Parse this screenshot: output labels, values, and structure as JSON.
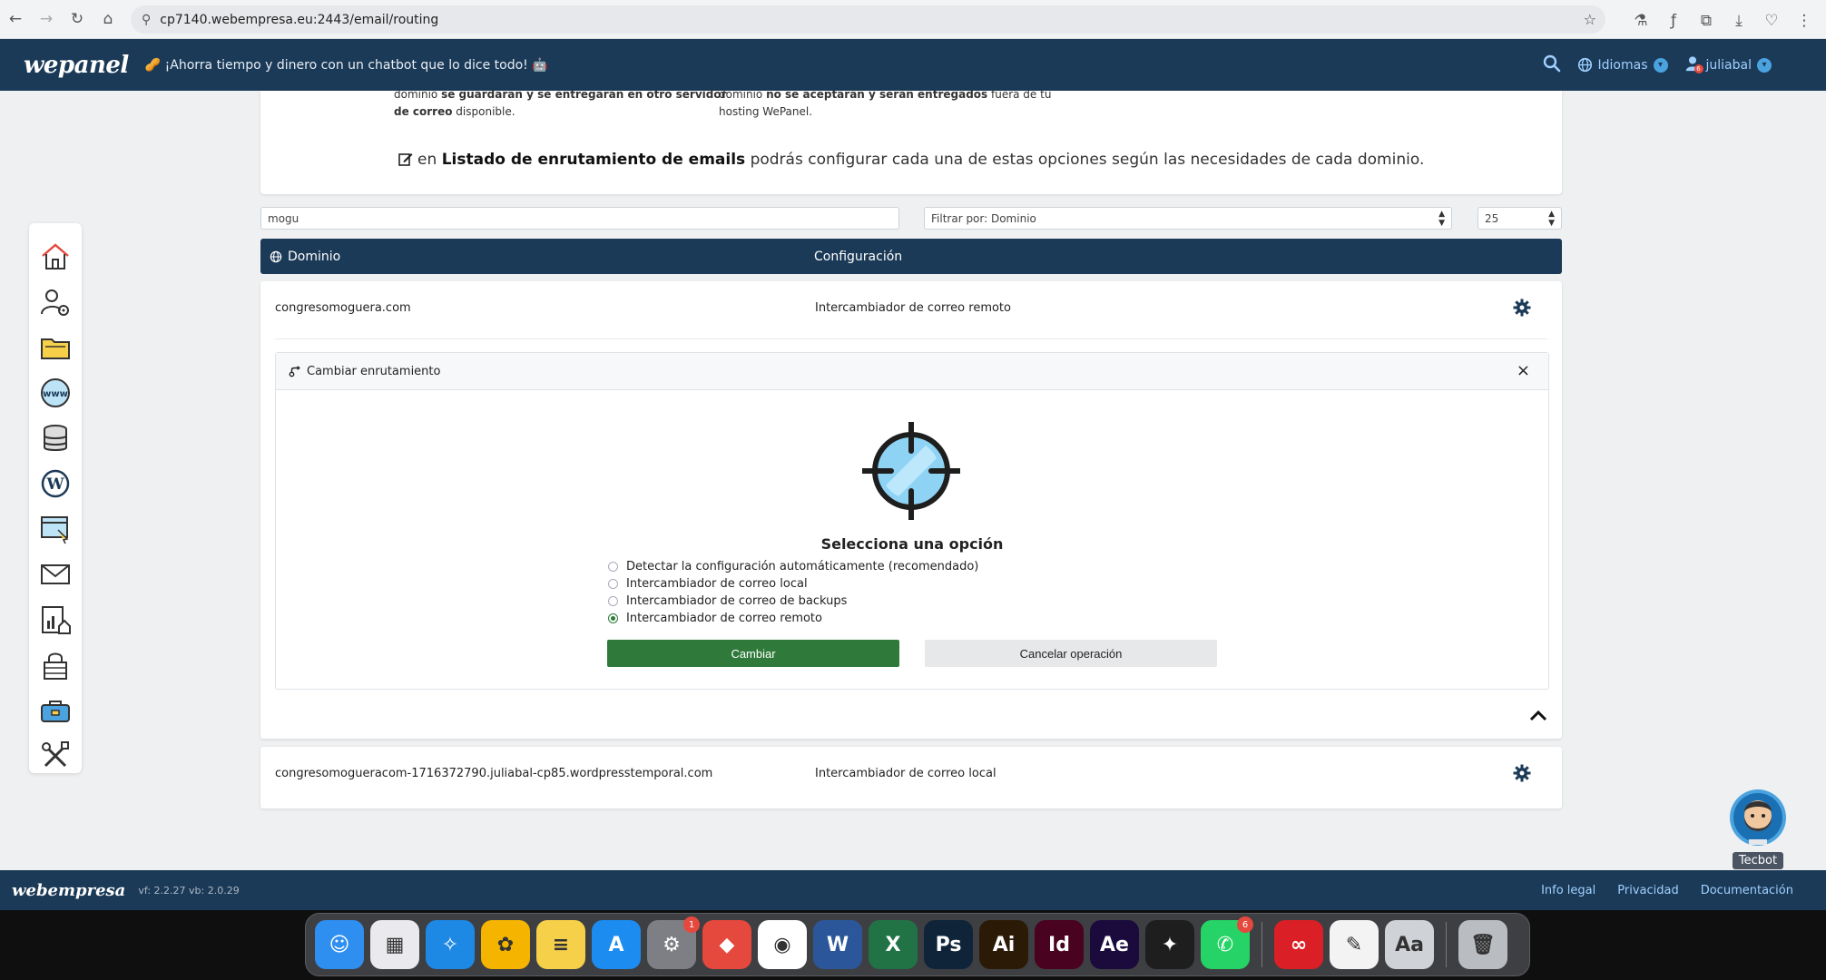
{
  "browser": {
    "url": "cp7140.webempresa.eu:2443/email/routing"
  },
  "topbar": {
    "logo": "wepanel",
    "promo": "🥜 ¡Ahorra tiempo y dinero con un chatbot que lo dice todo! 🤖",
    "languages_label": "Idiomas",
    "user_label": "juliabal",
    "user_badge": "6"
  },
  "info": {
    "col1_line1_pre": "dominio ",
    "col1_line1_bold": "se guardarán y se entregarán en otro servidor",
    "col1_line2_bold": "de correo",
    "col1_line2_post": " disponible.",
    "col2_line1_pre": "dominio ",
    "col2_line1_bold": "no se aceptarán y serán entregados",
    "col2_line1_post": " fuera de tu",
    "col2_line2": "hosting WePanel.",
    "note_pre": " en ",
    "note_bold": "Listado de enrutamiento de emails",
    "note_post": " podrás configurar cada una de estas opciones según las necesidades de cada dominio."
  },
  "filters": {
    "search_value": "mogu",
    "filter_by": "Filtrar por: Dominio",
    "per_page": "25"
  },
  "table": {
    "col_domain": "Dominio",
    "col_config": "Configuración",
    "rows": [
      {
        "domain": "congresomoguera.com",
        "config": "Intercambiador de correo remoto"
      },
      {
        "domain": "congresomogueracom-1716372790.juliabal-cp85.wordpresstemporal.com",
        "config": "Intercambiador de correo local"
      }
    ]
  },
  "routing_panel": {
    "title": "Cambiar enrutamiento",
    "heading": "Selecciona una opción",
    "options": [
      {
        "label": "Detectar la configuración automáticamente (recomendado)",
        "checked": false
      },
      {
        "label": "Intercambiador de correo local",
        "checked": false
      },
      {
        "label": "Intercambiador de correo de backups",
        "checked": false
      },
      {
        "label": "Intercambiador de correo remoto",
        "checked": true
      }
    ],
    "submit_label": "Cambiar",
    "cancel_label": "Cancelar operación"
  },
  "tecbot": {
    "label": "Tecbot"
  },
  "footer": {
    "logo": "webempresa",
    "version": "vf: 2.2.27 vb: 2.0.29",
    "links": [
      "Info legal",
      "Privacidad",
      "Documentación"
    ]
  },
  "dock": {
    "apps": [
      {
        "name": "Finder",
        "glyph": "☺",
        "color": "#2f8ff0",
        "badge": ""
      },
      {
        "name": "Launchpad",
        "glyph": "▦",
        "color": "#e9e9ee",
        "badge": ""
      },
      {
        "name": "Safari",
        "glyph": "✧",
        "color": "#1e88e5",
        "badge": ""
      },
      {
        "name": "Photos",
        "glyph": "✿",
        "color": "#f4b400",
        "badge": ""
      },
      {
        "name": "Notes",
        "glyph": "≡",
        "color": "#f7d04a",
        "badge": ""
      },
      {
        "name": "App Store",
        "glyph": "A",
        "color": "#1c8cf0",
        "badge": ""
      },
      {
        "name": "System Settings",
        "glyph": "⚙",
        "color": "#7d7f85",
        "badge": "1"
      },
      {
        "name": "AnyDesk",
        "glyph": "◆",
        "color": "#e5483d",
        "badge": ""
      },
      {
        "name": "Chrome",
        "glyph": "◉",
        "color": "#ffffff",
        "badge": ""
      },
      {
        "name": "Word",
        "glyph": "W",
        "color": "#2b579a",
        "badge": ""
      },
      {
        "name": "Excel",
        "glyph": "X",
        "color": "#217346",
        "badge": ""
      },
      {
        "name": "Photoshop",
        "glyph": "Ps",
        "color": "#0f2438",
        "badge": ""
      },
      {
        "name": "Illustrator",
        "glyph": "Ai",
        "color": "#2b1b06",
        "badge": ""
      },
      {
        "name": "InDesign",
        "glyph": "Id",
        "color": "#49021f",
        "badge": ""
      },
      {
        "name": "After Effects",
        "glyph": "Ae",
        "color": "#1a0b3c",
        "badge": ""
      },
      {
        "name": "Figma",
        "glyph": "✦",
        "color": "#1e1e1e",
        "badge": ""
      },
      {
        "name": "WhatsApp",
        "glyph": "✆",
        "color": "#25d366",
        "badge": "6"
      },
      {
        "name": "Creative Cloud",
        "glyph": "∞",
        "color": "#da1f26",
        "badge": ""
      },
      {
        "name": "TextEdit",
        "glyph": "✎",
        "color": "#f3f3f3",
        "badge": ""
      },
      {
        "name": "Font Book",
        "glyph": "Aa",
        "color": "#cfd2d6",
        "badge": ""
      },
      {
        "name": "Trash",
        "glyph": "🗑",
        "color": "#b9bcc0",
        "badge": ""
      }
    ]
  }
}
